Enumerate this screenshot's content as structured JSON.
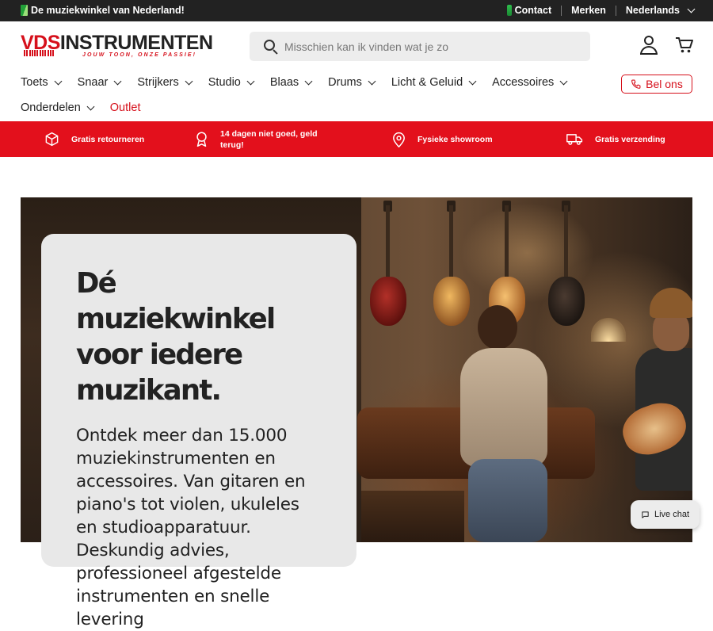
{
  "topbar": {
    "promo": "De muziekwinkel van Nederland!",
    "contact": "Contact",
    "brands": "Merken",
    "language": "Nederlands"
  },
  "logo": {
    "name_red": "VDS",
    "name_dark": "INSTRUMENTEN",
    "tagline": "JOUW TOON, ONZE PASSIE!"
  },
  "search": {
    "placeholder": "Misschien kan ik vinden wat je zo"
  },
  "nav": {
    "row1": [
      "Toets",
      "Snaar",
      "Strijkers",
      "Studio",
      "Blaas",
      "Drums",
      "Licht & Geluid",
      "Accessoires"
    ],
    "row2": [
      "Onderdelen"
    ],
    "outlet": "Outlet",
    "call": "Bel ons"
  },
  "usp": [
    {
      "icon": "box-icon",
      "text": "Gratis retourneren"
    },
    {
      "icon": "award-icon",
      "text": "14 dagen niet goed, geld terug!"
    },
    {
      "icon": "location-pin-icon",
      "text": "Fysieke showroom"
    },
    {
      "icon": "truck-icon",
      "text": "Gratis verzending"
    }
  ],
  "hero": {
    "title": "Dé muziekwinkel voor iedere muzikant.",
    "body": "Ontdek meer dan 15.000 muziekinstrumenten en accessoires. Van gitaren en piano's tot violen, ukuleles en studioapparatuur. Deskundig advies, professioneel afgestelde instrumenten en snelle levering"
  },
  "livechat": {
    "label": "Live chat"
  },
  "colors": {
    "brand_red": "#e3101c",
    "dark": "#222222",
    "search_bg": "#ededed"
  }
}
